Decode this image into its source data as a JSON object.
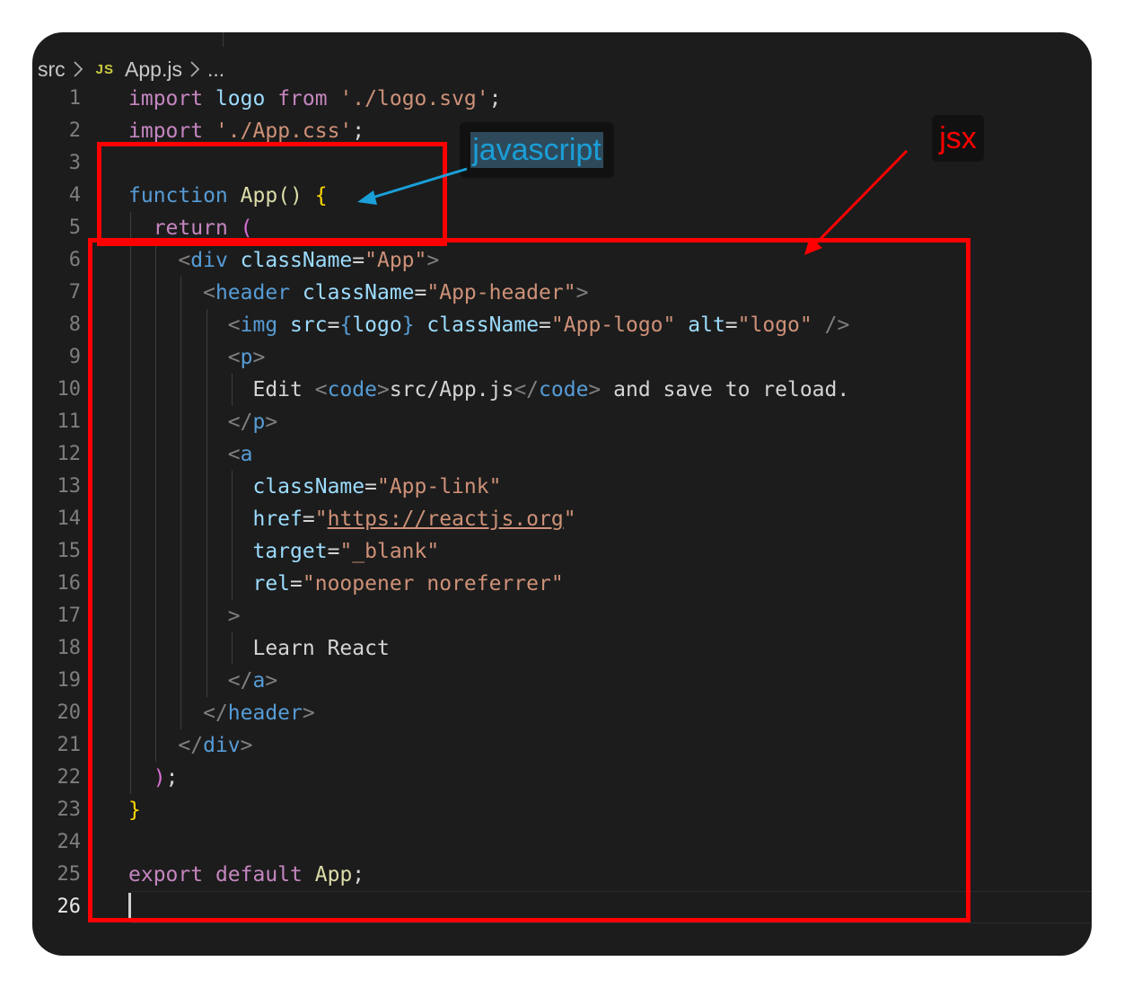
{
  "breadcrumb": {
    "folder": "src",
    "file_type_badge": "JS",
    "file_name": "App.js",
    "more": "..."
  },
  "editor": {
    "active_line": 26,
    "lines": [
      {
        "n": "1",
        "tokens": [
          [
            "import",
            "kw"
          ],
          [
            " ",
            "text"
          ],
          [
            "logo",
            "var"
          ],
          [
            " ",
            "text"
          ],
          [
            "from",
            "kw"
          ],
          [
            " ",
            "text"
          ],
          [
            "'./logo.svg'",
            "str"
          ],
          [
            ";",
            "punct"
          ]
        ]
      },
      {
        "n": "2",
        "tokens": [
          [
            "import",
            "kw"
          ],
          [
            " ",
            "text"
          ],
          [
            "'./App.css'",
            "str"
          ],
          [
            ";",
            "punct"
          ]
        ]
      },
      {
        "n": "3",
        "tokens": []
      },
      {
        "n": "4",
        "tokens": [
          [
            "function",
            "blue"
          ],
          [
            " ",
            "text"
          ],
          [
            "App",
            "fn"
          ],
          [
            "()",
            "fn"
          ],
          [
            " ",
            "text"
          ],
          [
            "{",
            "brace"
          ]
        ]
      },
      {
        "n": "5",
        "tokens": [
          [
            "  ",
            "text"
          ],
          [
            "return",
            "kw"
          ],
          [
            " ",
            "text"
          ],
          [
            "(",
            "paren"
          ]
        ]
      },
      {
        "n": "6",
        "tokens": [
          [
            "    ",
            "text"
          ],
          [
            "<",
            "angle"
          ],
          [
            "div",
            "tag"
          ],
          [
            " ",
            "text"
          ],
          [
            "className",
            "attr"
          ],
          [
            "=",
            "punct"
          ],
          [
            "\"App\"",
            "str"
          ],
          [
            ">",
            "angle"
          ]
        ]
      },
      {
        "n": "7",
        "tokens": [
          [
            "      ",
            "text"
          ],
          [
            "<",
            "angle"
          ],
          [
            "header",
            "tag"
          ],
          [
            " ",
            "text"
          ],
          [
            "className",
            "attr"
          ],
          [
            "=",
            "punct"
          ],
          [
            "\"App-header\"",
            "str"
          ],
          [
            ">",
            "angle"
          ]
        ]
      },
      {
        "n": "8",
        "tokens": [
          [
            "        ",
            "text"
          ],
          [
            "<",
            "angle"
          ],
          [
            "img",
            "tag"
          ],
          [
            " ",
            "text"
          ],
          [
            "src",
            "attr"
          ],
          [
            "=",
            "punct"
          ],
          [
            "{",
            "blue"
          ],
          [
            "logo",
            "var"
          ],
          [
            "}",
            "blue"
          ],
          [
            " ",
            "text"
          ],
          [
            "className",
            "attr"
          ],
          [
            "=",
            "punct"
          ],
          [
            "\"App-logo\"",
            "str"
          ],
          [
            " ",
            "text"
          ],
          [
            "alt",
            "attr"
          ],
          [
            "=",
            "punct"
          ],
          [
            "\"logo\"",
            "str"
          ],
          [
            " ",
            "text"
          ],
          [
            "/>",
            "angle"
          ]
        ]
      },
      {
        "n": "9",
        "tokens": [
          [
            "        ",
            "text"
          ],
          [
            "<",
            "angle"
          ],
          [
            "p",
            "tag"
          ],
          [
            ">",
            "angle"
          ]
        ]
      },
      {
        "n": "10",
        "tokens": [
          [
            "          ",
            "text"
          ],
          [
            "Edit ",
            "text"
          ],
          [
            "<",
            "angle"
          ],
          [
            "code",
            "tag"
          ],
          [
            ">",
            "angle"
          ],
          [
            "src/App.js",
            "text"
          ],
          [
            "</",
            "angle"
          ],
          [
            "code",
            "tag"
          ],
          [
            ">",
            "angle"
          ],
          [
            " and save to reload.",
            "text"
          ]
        ]
      },
      {
        "n": "11",
        "tokens": [
          [
            "        ",
            "text"
          ],
          [
            "</",
            "angle"
          ],
          [
            "p",
            "tag"
          ],
          [
            ">",
            "angle"
          ]
        ]
      },
      {
        "n": "12",
        "tokens": [
          [
            "        ",
            "text"
          ],
          [
            "<",
            "angle"
          ],
          [
            "a",
            "tag"
          ]
        ]
      },
      {
        "n": "13",
        "tokens": [
          [
            "          ",
            "text"
          ],
          [
            "className",
            "attr"
          ],
          [
            "=",
            "punct"
          ],
          [
            "\"App-link\"",
            "str"
          ]
        ]
      },
      {
        "n": "14",
        "tokens": [
          [
            "          ",
            "text"
          ],
          [
            "href",
            "attr"
          ],
          [
            "=",
            "punct"
          ],
          [
            "\"",
            "str"
          ],
          [
            "https://reactjs.org",
            "url"
          ],
          [
            "\"",
            "str"
          ]
        ]
      },
      {
        "n": "15",
        "tokens": [
          [
            "          ",
            "text"
          ],
          [
            "target",
            "attr"
          ],
          [
            "=",
            "punct"
          ],
          [
            "\"_blank\"",
            "str"
          ]
        ]
      },
      {
        "n": "16",
        "tokens": [
          [
            "          ",
            "text"
          ],
          [
            "rel",
            "attr"
          ],
          [
            "=",
            "punct"
          ],
          [
            "\"noopener noreferrer\"",
            "str"
          ]
        ]
      },
      {
        "n": "17",
        "tokens": [
          [
            "        ",
            "text"
          ],
          [
            ">",
            "angle"
          ]
        ]
      },
      {
        "n": "18",
        "tokens": [
          [
            "          ",
            "text"
          ],
          [
            "Learn React",
            "text"
          ]
        ]
      },
      {
        "n": "19",
        "tokens": [
          [
            "        ",
            "text"
          ],
          [
            "</",
            "angle"
          ],
          [
            "a",
            "tag"
          ],
          [
            ">",
            "angle"
          ]
        ]
      },
      {
        "n": "20",
        "tokens": [
          [
            "      ",
            "text"
          ],
          [
            "</",
            "angle"
          ],
          [
            "header",
            "tag"
          ],
          [
            ">",
            "angle"
          ]
        ]
      },
      {
        "n": "21",
        "tokens": [
          [
            "    ",
            "text"
          ],
          [
            "</",
            "angle"
          ],
          [
            "div",
            "tag"
          ],
          [
            ">",
            "angle"
          ]
        ]
      },
      {
        "n": "22",
        "tokens": [
          [
            "  ",
            "text"
          ],
          [
            ")",
            "paren"
          ],
          [
            ";",
            "punct"
          ]
        ]
      },
      {
        "n": "23",
        "tokens": [
          [
            "}",
            "brace"
          ]
        ]
      },
      {
        "n": "24",
        "tokens": []
      },
      {
        "n": "25",
        "tokens": [
          [
            "export",
            "kw"
          ],
          [
            " ",
            "text"
          ],
          [
            "default",
            "kw"
          ],
          [
            " ",
            "text"
          ],
          [
            "App",
            "fn"
          ],
          [
            ";",
            "punct"
          ]
        ]
      },
      {
        "n": "26",
        "tokens": []
      }
    ]
  },
  "annotations": {
    "javascript_label": "javascript",
    "javascript_color": "#1a9fd8",
    "jsx_label": "jsx",
    "jsx_color": "#ff0000",
    "box_color": "#ff0000"
  }
}
